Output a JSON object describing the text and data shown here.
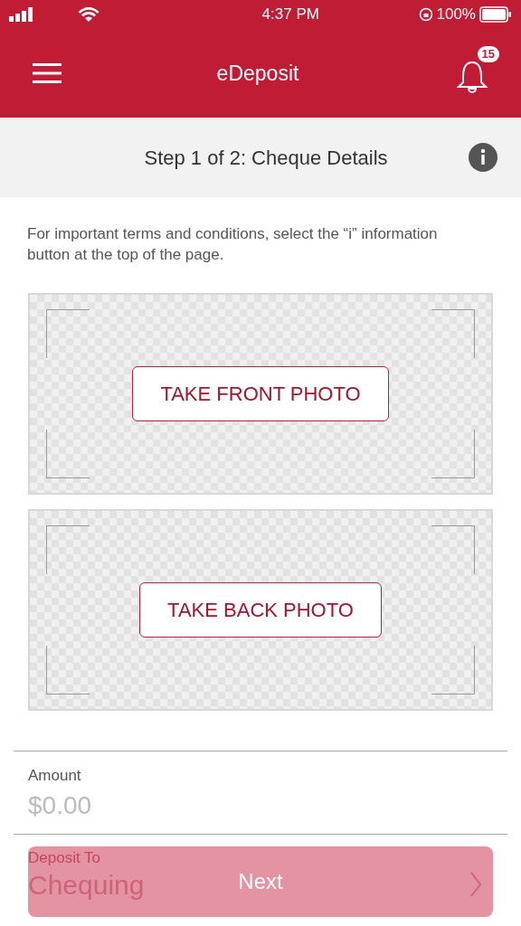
{
  "status_bar": {
    "time": "4:37 PM",
    "battery": "100%"
  },
  "header": {
    "title": "eDeposit",
    "notifications": "15"
  },
  "step": {
    "title": "Step 1 of 2: Cheque Details"
  },
  "notice": "For important terms and conditions, select the “i” information button at the top of the page.",
  "photo_slots": [
    {
      "button": "TAKE FRONT PHOTO"
    },
    {
      "button": "TAKE BACK PHOTO"
    }
  ],
  "amount": {
    "label": "Amount",
    "placeholder": "$0.00"
  },
  "deposit_to": {
    "label": "Deposit To",
    "value": "Chequing"
  },
  "next_button": {
    "label": "Next",
    "disabled": true
  }
}
